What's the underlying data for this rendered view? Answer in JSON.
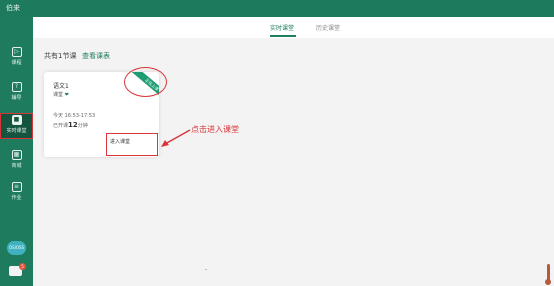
{
  "app": {
    "name": "伯来"
  },
  "sidebar": {
    "items": [
      {
        "label": "课程",
        "icon": "play-icon",
        "glyph": "▷"
      },
      {
        "label": "辅导",
        "icon": "question-icon",
        "glyph": "?"
      },
      {
        "label": "实时课堂",
        "icon": "live-class-icon",
        "glyph": "■"
      },
      {
        "label": "商城",
        "icon": "store-icon",
        "glyph": "▦"
      },
      {
        "label": "作业",
        "icon": "homework-icon",
        "glyph": "≡"
      }
    ],
    "active_index": 2,
    "avatar_label": "OSIOSS",
    "message_badge": "5"
  },
  "tabs": [
    {
      "label": "实时课堂",
      "active": true
    },
    {
      "label": "历史课堂",
      "active": false
    }
  ],
  "summary": {
    "count_text": "共有1节课",
    "view_list_label": "查看课表"
  },
  "course_card": {
    "title": "语文1",
    "subject": "课堂",
    "time": "今天 16:53-17:53",
    "elapsed_prefix": "已开课",
    "elapsed_value": "12",
    "elapsed_suffix": "分钟",
    "ribbon": "正在上课",
    "enter_label": "进入课堂"
  },
  "annotation": {
    "text": "点击进入课堂",
    "color": "#d9363b"
  },
  "colors": {
    "brand": "#1d7a5c",
    "accent": "#1f7d5f",
    "annotation": "#d9363b"
  }
}
